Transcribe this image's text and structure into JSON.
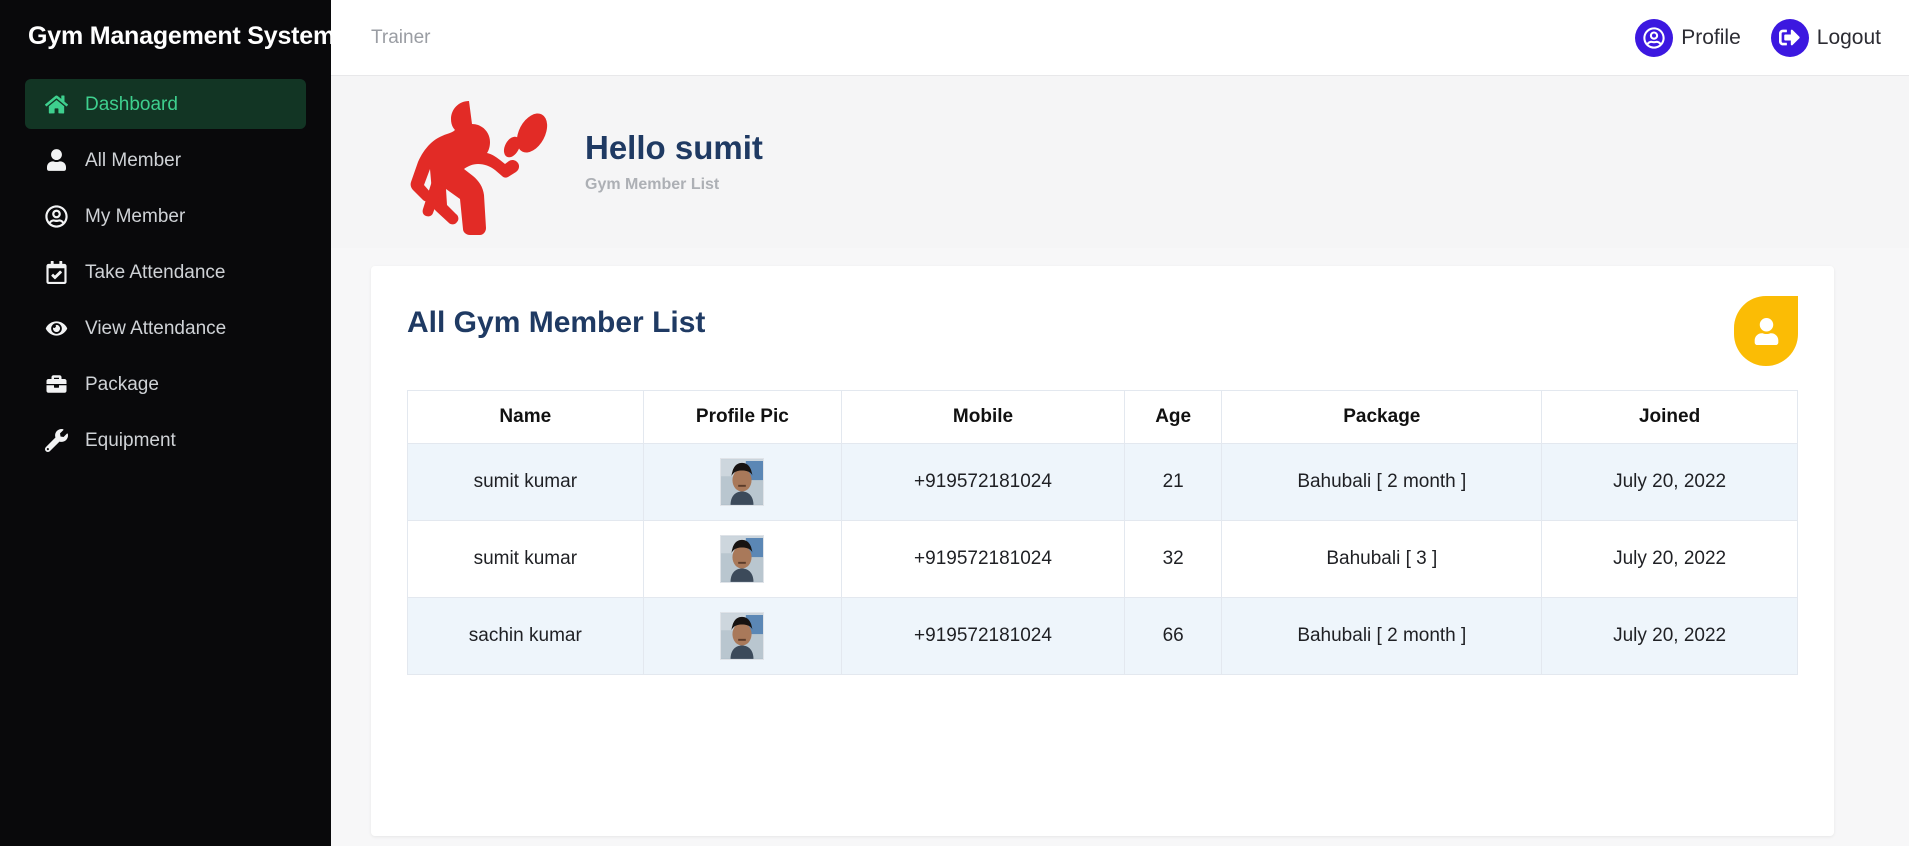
{
  "sidebar": {
    "brand": "Gym Management System",
    "items": [
      {
        "label": "Dashboard",
        "icon": "home-icon",
        "active": true
      },
      {
        "label": "All Member",
        "icon": "user-icon",
        "active": false
      },
      {
        "label": "My Member",
        "icon": "user-circle-icon",
        "active": false
      },
      {
        "label": "Take Attendance",
        "icon": "calendar-check-icon",
        "active": false
      },
      {
        "label": "View Attendance",
        "icon": "eye-icon",
        "active": false
      },
      {
        "label": "Package",
        "icon": "briefcase-icon",
        "active": false
      },
      {
        "label": "Equipment",
        "icon": "wrench-icon",
        "active": false
      }
    ],
    "active_bg": "#123524",
    "active_color": "#3ecf8e",
    "background": "#09090b"
  },
  "topbar": {
    "breadcrumb": "Trainer",
    "profile_label": "Profile",
    "profile_icon": "user-circle-icon",
    "logout_label": "Logout",
    "logout_icon": "sign-out-icon",
    "button_color": "#3c18e0"
  },
  "hero": {
    "logo_icon": "bodybuilder-dumbbell-logo",
    "logo_color": "#e22b26",
    "greeting": "Hello sumit",
    "subtitle": "Gym Member List",
    "greeting_color": "#1f3a63"
  },
  "card": {
    "title": "All Gym Member List",
    "badge_icon": "user-icon",
    "badge_color": "#fbbc05"
  },
  "table": {
    "columns": [
      "Name",
      "Profile Pic",
      "Mobile",
      "Age",
      "Package",
      "Joined"
    ],
    "rows": [
      {
        "name": "sumit kumar",
        "profile_pic": "member-photo",
        "mobile": "+919572181024",
        "age": "21",
        "package": "Bahubali [ 2 month ]",
        "joined": "July 20, 2022"
      },
      {
        "name": "sumit kumar",
        "profile_pic": "member-photo",
        "mobile": "+919572181024",
        "age": "32",
        "package": "Bahubali [ 3 ]",
        "joined": "July 20, 2022"
      },
      {
        "name": "sachin kumar",
        "profile_pic": "member-photo",
        "mobile": "+919572181024",
        "age": "66",
        "package": "Bahubali [ 2 month ]",
        "joined": "July 20, 2022"
      }
    ]
  }
}
